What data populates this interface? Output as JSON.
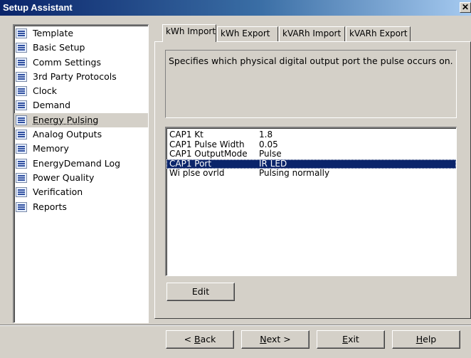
{
  "window": {
    "title": "Setup Assistant",
    "close_glyph": "✕"
  },
  "nav": {
    "items": [
      {
        "label": "Template"
      },
      {
        "label": "Basic Setup"
      },
      {
        "label": "Comm Settings"
      },
      {
        "label": "3rd Party Protocols"
      },
      {
        "label": "Clock"
      },
      {
        "label": "Demand"
      },
      {
        "label": "Energy Pulsing",
        "selected": true
      },
      {
        "label": "Analog Outputs"
      },
      {
        "label": "Memory"
      },
      {
        "label": "EnergyDemand Log"
      },
      {
        "label": "Power Quality"
      },
      {
        "label": "Verification"
      },
      {
        "label": "Reports"
      }
    ],
    "icon": "document-icon"
  },
  "tabs": [
    {
      "label": "kWh Import",
      "active": true
    },
    {
      "label": "kWh Export"
    },
    {
      "label": "kVARh Import"
    },
    {
      "label": "kVARh Export"
    }
  ],
  "description": "Specifies which physical digital output port the pulse occurs on.",
  "params": [
    {
      "name": "CAP1 Kt",
      "value": "1.8"
    },
    {
      "name": "CAP1 Pulse Width",
      "value": "0.05"
    },
    {
      "name": "CAP1 OutputMode",
      "value": "Pulse"
    },
    {
      "name": "CAP1 Port",
      "value": "IR LED",
      "selected": true
    },
    {
      "name": "Wi plse ovrld",
      "value": "Pulsing normally"
    }
  ],
  "buttons": {
    "edit": "Edit",
    "back_mnemonic": "B",
    "back_prefix": "< ",
    "back_rest": "ack",
    "next_mnemonic": "N",
    "next_rest": "ext >",
    "exit_mnemonic": "E",
    "exit_rest": "xit",
    "help_mnemonic": "H",
    "help_rest": "elp"
  },
  "colors": {
    "title_bar": "#0a246a",
    "selection": "#0a246a",
    "face": "#d4d0c8"
  }
}
